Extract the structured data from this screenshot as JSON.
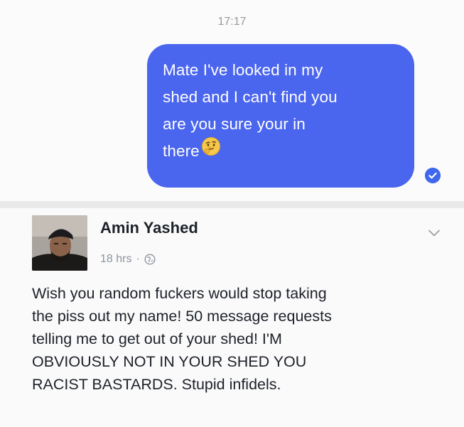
{
  "chat": {
    "timestamp": "17:17",
    "message_lines": [
      "Mate I've looked in my",
      "shed and I can't find you",
      "are you sure your in",
      "there"
    ],
    "emoji": "thinking-face-icon",
    "seen_icon": "check-circle-icon",
    "bubble_color": "#4a65ee"
  },
  "post": {
    "author": "Amin Yashed",
    "time": "18 hrs",
    "separator": "·",
    "privacy_icon": "globe-icon",
    "menu_icon": "chevron-down-icon",
    "body_lines": [
      "Wish you random fuckers would stop taking",
      "the piss out my name! 50 message requests",
      "telling me to get out of your shed! I'M",
      "OBVIOUSLY NOT IN YOUR SHED YOU",
      "RACIST BASTARDS. Stupid infidels."
    ]
  }
}
